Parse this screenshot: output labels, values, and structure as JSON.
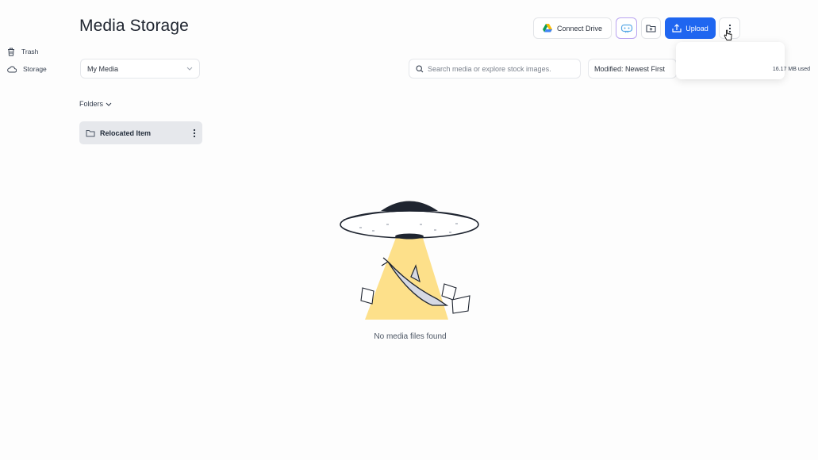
{
  "page": {
    "title": "Media Storage"
  },
  "toolbar": {
    "connect_drive_label": "Connect Drive",
    "upload_label": "Upload",
    "icons": {
      "drive": "google-drive-icon",
      "ai": "ai-assistant-icon",
      "new_folder": "folder-plus-icon",
      "upload": "upload-icon",
      "more": "more-vertical-icon"
    }
  },
  "filters": {
    "media_select": "My Media",
    "search_placeholder": "Search media or explore stock images.",
    "sort_label": "Modified: Newest First"
  },
  "folders": {
    "toggle_label": "Folders",
    "items": [
      {
        "label": "Relocated Item"
      }
    ]
  },
  "dropdown_menu": {
    "items": [
      {
        "label": "Trash",
        "icon": "trash-icon"
      },
      {
        "label": "Storage",
        "icon": "cloud-icon",
        "detail": "16.17 MB used"
      }
    ]
  },
  "empty_state": {
    "message": "No media files found"
  },
  "colors": {
    "primary": "#1f66f0",
    "ai_border": "#b9a4f0",
    "beam": "#fde08a",
    "folder_bg": "#e6e8ec"
  }
}
